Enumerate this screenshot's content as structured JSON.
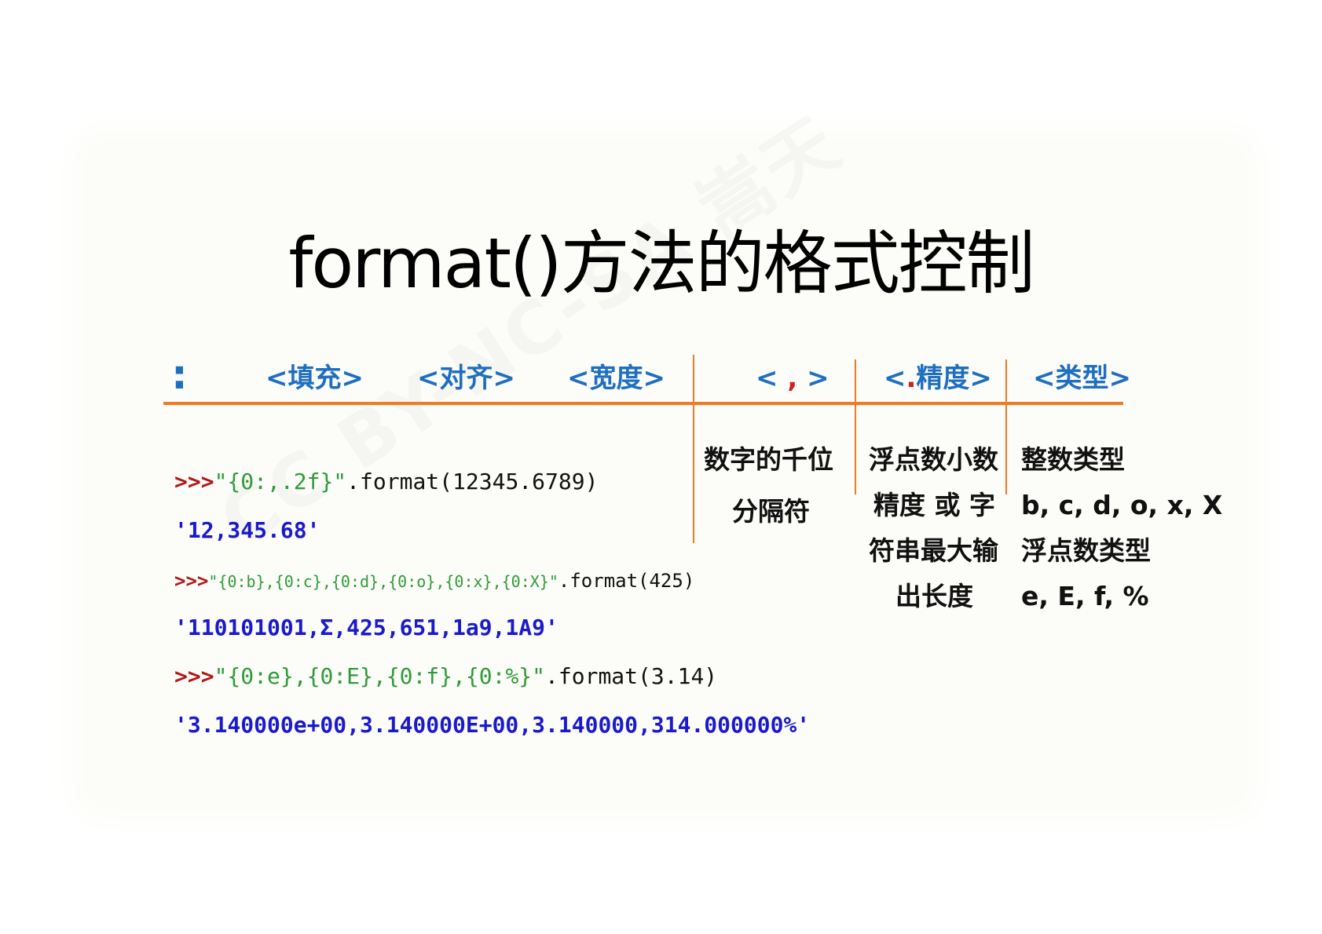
{
  "title": "format()方法的格式控制",
  "watermark": "CC BY-NC-SA 嵩天",
  "header": {
    "colon": ":",
    "fill": "<填充>",
    "align": "<对齐>",
    "width": "<宽度>",
    "comma_open": "<",
    "comma_mark": ",",
    "comma_close": ">",
    "precision_open": "<",
    "precision_dot": ".",
    "precision_label": "精度>",
    "type": "<类型>"
  },
  "descriptions": {
    "comma": [
      "数字的千位",
      "分隔符"
    ],
    "precision": [
      "浮点数小数",
      "精度 或 字",
      "符串最大输",
      "出长度"
    ],
    "type": [
      "整数类型",
      "b, c, d, o, x, X",
      "浮点数类型",
      "e, E, f, %"
    ]
  },
  "examples": [
    {
      "prompt": ">>>",
      "format_string": "\"{0:,.2f}\"",
      "call": ".format(12345.6789)",
      "output": "'12,345.68'"
    },
    {
      "prompt": ">>>",
      "format_string": "\"{0:b},{0:c},{0:d},{0:o},{0:x},{0:X}\"",
      "call": ".format(425)",
      "output": "'110101001,Σ,425,651,1a9,1A9'"
    },
    {
      "prompt": ">>>",
      "format_string": "\"{0:e},{0:E},{0:f},{0:%}\"",
      "call": ".format(3.14)",
      "output": "'3.140000e+00,3.140000E+00,3.140000,314.000000%'"
    }
  ],
  "colors": {
    "header_blue": "#1f6fc0",
    "rule_orange": "#f07b22",
    "prompt_red": "#b01818",
    "string_green": "#2f9b38",
    "output_blue": "#1a1acc",
    "accent_red": "#d0201c"
  }
}
